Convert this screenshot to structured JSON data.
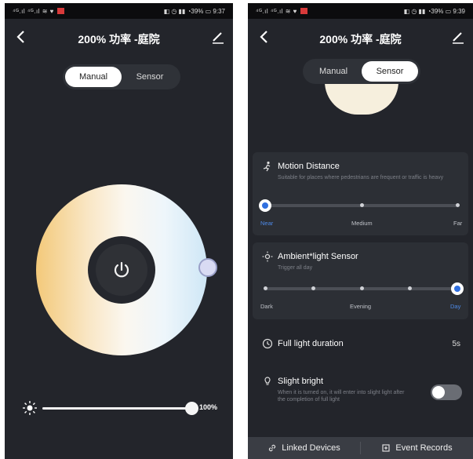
{
  "screens": {
    "left": {
      "status": {
        "left": "⁴ᴳ.ıl ⁴ᴳ.ıl ≋ ♥",
        "right": "◧ ◷ ▮▮ ◔39% ▭ 9:37"
      },
      "title": "200% 功率 -庭院",
      "mode_tabs": [
        "Manual",
        "Sensor"
      ],
      "active_tab": "Manual",
      "brightness": {
        "value_label": "100%",
        "level": 1.0
      }
    },
    "right": {
      "status": {
        "left": "⁴ᴳ.ıl ⁴ᴳ.ıl ≋ ♥",
        "right": "◧ ◷ ▮▮ ◔39% ▭ 9:39"
      },
      "title": "200% 功率 -庭院",
      "mode_tabs": [
        "Manual",
        "Sensor"
      ],
      "active_tab": "Sensor",
      "motion_distance": {
        "title": "Motion Distance",
        "description": "Suitable for places where pedestrians are frequent or traffic is heavy",
        "ticks": [
          "Near",
          "Medium",
          "Far"
        ],
        "selected": "Near"
      },
      "ambient_sensor": {
        "title": "Ambient*light Sensor",
        "description": "Trigger all day",
        "ticks": [
          "Dark",
          "Evening",
          "Day"
        ],
        "selected": "Day"
      },
      "full_light_duration": {
        "title": "Full light duration",
        "value": "5s"
      },
      "slight_bright": {
        "title": "Slight bright",
        "description": "When it is turned on, it will enter into slight light after the completion of full light",
        "enabled": false
      },
      "bottom_bar": {
        "linked": "Linked Devices",
        "events": "Event Records"
      }
    }
  },
  "colors": {
    "background": "#23252b",
    "accent": "#4d8ae8",
    "card": "#2c2f35"
  },
  "icons": [
    "back-icon",
    "edit-icon",
    "power-icon",
    "sun-icon",
    "motion-icon",
    "light-sensor-icon",
    "clock-icon",
    "bulb-icon",
    "link-icon",
    "record-icon"
  ]
}
